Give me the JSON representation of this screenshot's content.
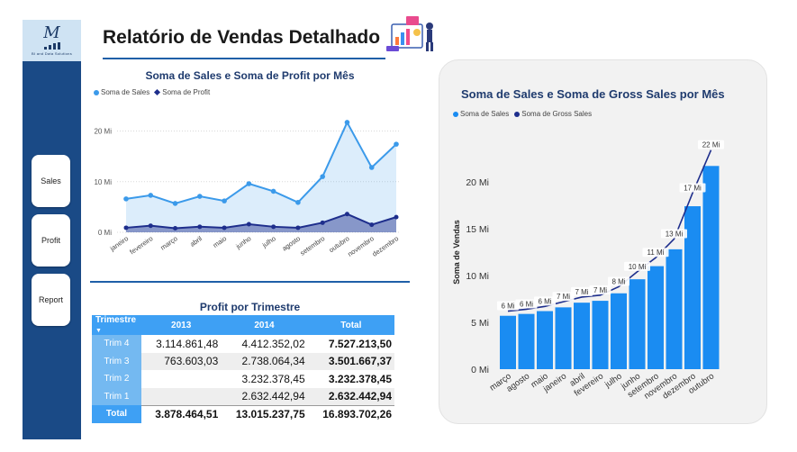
{
  "header": {
    "title": "Relatório de Vendas Detalhado"
  },
  "logo": {
    "tagline": "BI and Data Solutions"
  },
  "nav": [
    {
      "label": "Sales"
    },
    {
      "label": "Profit"
    },
    {
      "label": "Report"
    }
  ],
  "chart1": {
    "title": "Soma de Sales e Soma de Profit por Mês",
    "legend": [
      "Soma de  Sales",
      "Soma de Profit"
    ]
  },
  "chart2": {
    "title": "Soma de Sales e Soma de Gross Sales por Mês",
    "legend": [
      "Soma de  Sales",
      "Soma de Gross Sales"
    ]
  },
  "table": {
    "title": "Profit por Trimestre",
    "headers": [
      "Trimestre",
      "2013",
      "2014",
      "Total"
    ],
    "rows": [
      {
        "label": "Trim 4",
        "y2013": "3.114.861,48",
        "y2014": "4.412.352,02",
        "total": "7.527.213,50"
      },
      {
        "label": "Trim 3",
        "y2013": "763.603,03",
        "y2014": "2.738.064,34",
        "total": "3.501.667,37"
      },
      {
        "label": "Trim 2",
        "y2013": "",
        "y2014": "3.232.378,45",
        "total": "3.232.378,45"
      },
      {
        "label": "Trim 1",
        "y2013": "",
        "y2014": "2.632.442,94",
        "total": "2.632.442,94"
      }
    ],
    "total_row": {
      "label": "Total",
      "y2013": "3.878.464,51",
      "y2014": "13.015.237,75",
      "total": "16.893.702,26"
    }
  },
  "colors": {
    "sales": "#3b9aea",
    "profit": "#1e2e8c",
    "bar": "#1a8cf2",
    "gross_line": "#1e2e8c",
    "accent": "#1f5fa8",
    "sidebar": "#1a4a86"
  },
  "chart_data": [
    {
      "type": "area",
      "title": "Soma de Sales e Soma de Profit por Mês",
      "categories": [
        "janeiro",
        "fevereiro",
        "março",
        "abril",
        "maio",
        "junho",
        "julho",
        "agosto",
        "setembro",
        "outubro",
        "novembro",
        "dezembro"
      ],
      "series": [
        {
          "name": "Soma de  Sales",
          "values": [
            6.6,
            7.3,
            5.7,
            7.1,
            6.2,
            9.6,
            8.1,
            5.9,
            11.0,
            21.7,
            12.8,
            17.4
          ]
        },
        {
          "name": "Soma de Profit",
          "values": [
            0.9,
            1.3,
            0.8,
            1.1,
            0.9,
            1.6,
            1.1,
            0.9,
            1.9,
            3.6,
            1.5,
            3.0
          ]
        }
      ],
      "yticks": [
        "0 Mi",
        "10 Mi",
        "20 Mi"
      ],
      "ylim": [
        0,
        24
      ],
      "legend_position": "top-left",
      "grid": true
    },
    {
      "type": "bar",
      "title": "Soma de Sales e Soma de Gross Sales por Mês",
      "categories": [
        "março",
        "agosto",
        "maio",
        "janeiro",
        "abril",
        "fevereiro",
        "julho",
        "junho",
        "setembro",
        "novembro",
        "dezembro",
        "outubro"
      ],
      "series": [
        {
          "name": "Soma de  Sales",
          "values": [
            5.7,
            5.9,
            6.2,
            6.6,
            7.1,
            7.3,
            8.1,
            9.6,
            11.0,
            12.8,
            17.4,
            21.7
          ]
        },
        {
          "name": "Soma de Gross Sales",
          "values": [
            6.2,
            6.4,
            6.7,
            7.2,
            7.7,
            7.9,
            8.8,
            10.4,
            11.9,
            13.9,
            18.8,
            23.4
          ]
        }
      ],
      "data_labels": [
        "6 Mi",
        "6 Mi",
        "6 Mi",
        "7 Mi",
        "7 Mi",
        "7 Mi",
        "8 Mi",
        "10 Mi",
        "11 Mi",
        "13 Mi",
        "17 Mi",
        "22 Mi"
      ],
      "yticks": [
        "0 Mi",
        "5 Mi",
        "10 Mi",
        "15 Mi",
        "20 Mi"
      ],
      "ylabel": "Soma de Vendas",
      "ylim": [
        0,
        25
      ],
      "legend_position": "top-left",
      "grid": false
    }
  ]
}
